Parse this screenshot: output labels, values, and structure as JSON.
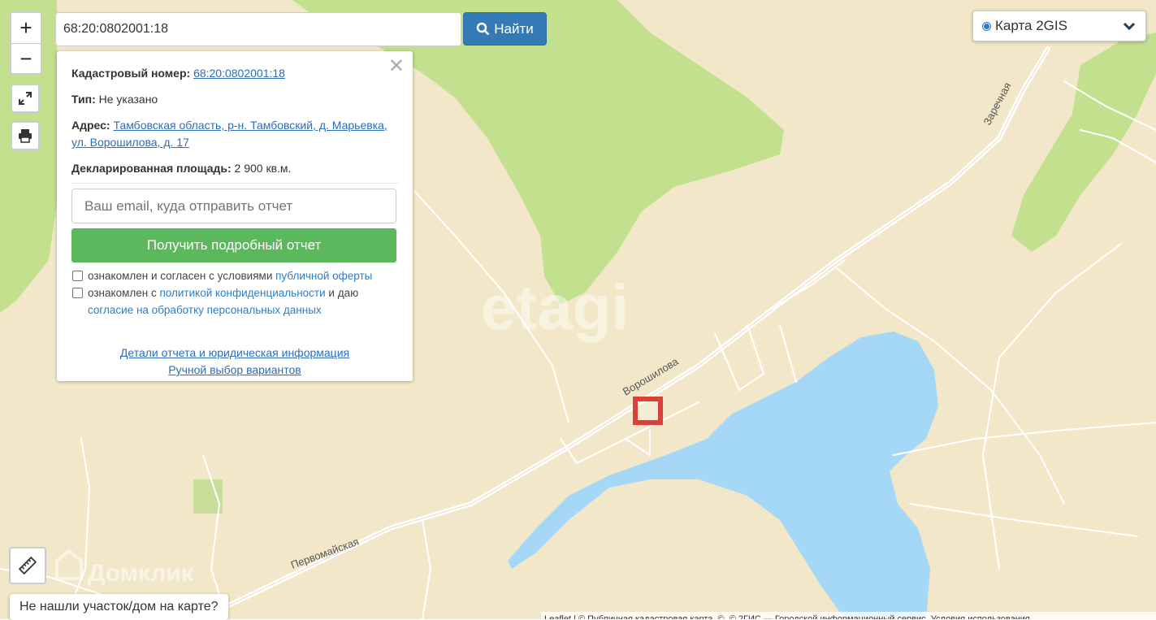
{
  "search": {
    "value": "68:20:0802001:18",
    "button_label": "Найти"
  },
  "layer_switcher": {
    "selected": "Карта 2GIS"
  },
  "zoom": {
    "in": "+",
    "out": "−"
  },
  "popup": {
    "cadastral_label": "Кадастровый номер:",
    "cadastral_value": "68:20:0802001:18",
    "type_label": "Тип:",
    "type_value": "Не указано",
    "address_label": "Адрес:",
    "address_value": "Тамбовская область, р-н. Тамбовский, д. Марьевка, ул. Ворошилова, д. 17",
    "area_label": "Декларированная площадь:",
    "area_value": "2 900 кв.м.",
    "email_placeholder": "Ваш email, куда отправить отчет",
    "get_report": "Получить подробный отчет",
    "consent1_prefix": "ознакомлен и согласен с условиями",
    "consent1_link": "публичной оферты",
    "consent2_prefix": "ознакомлен с",
    "consent2_link": "политикой конфиденциальности",
    "consent2_mid": "и даю",
    "consent2_link2": "согласие на обработку персональных данных",
    "details_link": "Детали отчета и юридическая информация",
    "manual_link": "Ручной выбор вариантов"
  },
  "map_labels": {
    "street1": "Ворошилова",
    "street2": "Первомайская",
    "street3": "Заречная",
    "watermark1": "etagi",
    "watermark2": "Домклик"
  },
  "not_found": "Не нашли участок/дом на карте?",
  "attribution": "Leaflet | © Публичная кадастровая карта, ©, © 2ГИС — Городской информационный сервис, Условия использования",
  "colors": {
    "land": "#f2e8c9",
    "forest": "#c2e08e",
    "water": "#a4d8f6",
    "road": "#ffffff",
    "parcel": "#d9423a",
    "button_blue": "#337ab7",
    "button_green": "#5cb85c"
  }
}
